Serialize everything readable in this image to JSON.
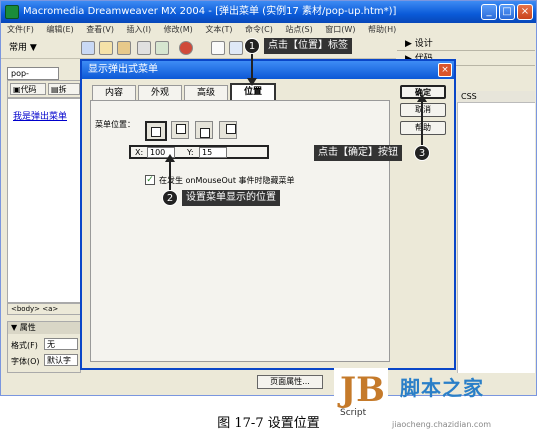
{
  "window": {
    "title": "Macromedia Dreamweaver MX 2004 - [弹出菜单 (实例17  素材/pop-up.htm*)]",
    "controls": [
      "_",
      "□",
      "×"
    ]
  },
  "menubar": [
    "文件(F)",
    "编辑(E)",
    "查看(V)",
    "插入(I)",
    "修改(M)",
    "文本(T)",
    "命令(C)",
    "站点(S)",
    "窗口(W)",
    "帮助(H)"
  ],
  "toolbar": {
    "category": "常用"
  },
  "right_panel": {
    "items": [
      "▶ 设计",
      "▶ 代码"
    ],
    "css_label": "CSS"
  },
  "document": {
    "tab": "pop-up.htm*",
    "code_btn": "代码",
    "split_btn": "拆",
    "link_text": "我是弹出菜单",
    "tag_selector": "<body> <a>"
  },
  "properties": {
    "header": "▼ 属性",
    "format_label": "格式(F)",
    "format_value": "无",
    "font_label": "字体(O)",
    "font_value": "默认字体"
  },
  "page_props_button": "页面属性...",
  "dialog": {
    "title": "显示弹出式菜单",
    "tabs": [
      "内容",
      "外观",
      "高级",
      "位置"
    ],
    "active_tab": 3,
    "menu_position_label": "菜单位置：",
    "x_label": "X:",
    "x_value": "100",
    "y_label": "Y:",
    "y_value": "15",
    "checkbox_label": "在发生 onMouseOut 事件时隐藏菜单",
    "checkbox_checked": true,
    "buttons": {
      "ok": "确定",
      "cancel": "取消",
      "help": "帮助"
    }
  },
  "annotations": {
    "a1": {
      "num": "1",
      "text": "点击【位置】标签"
    },
    "a2": {
      "num": "2",
      "text": "设置菜单显示的位置"
    },
    "a3": {
      "num": "3",
      "text": "点击【确定】按钮"
    }
  },
  "caption": "图 17-7    设置位置",
  "watermark": {
    "logo_letter": "JB",
    "logo_script": "Script",
    "site_name": "脚本之家",
    "site_url": "jiaocheng.chazidian.com"
  }
}
